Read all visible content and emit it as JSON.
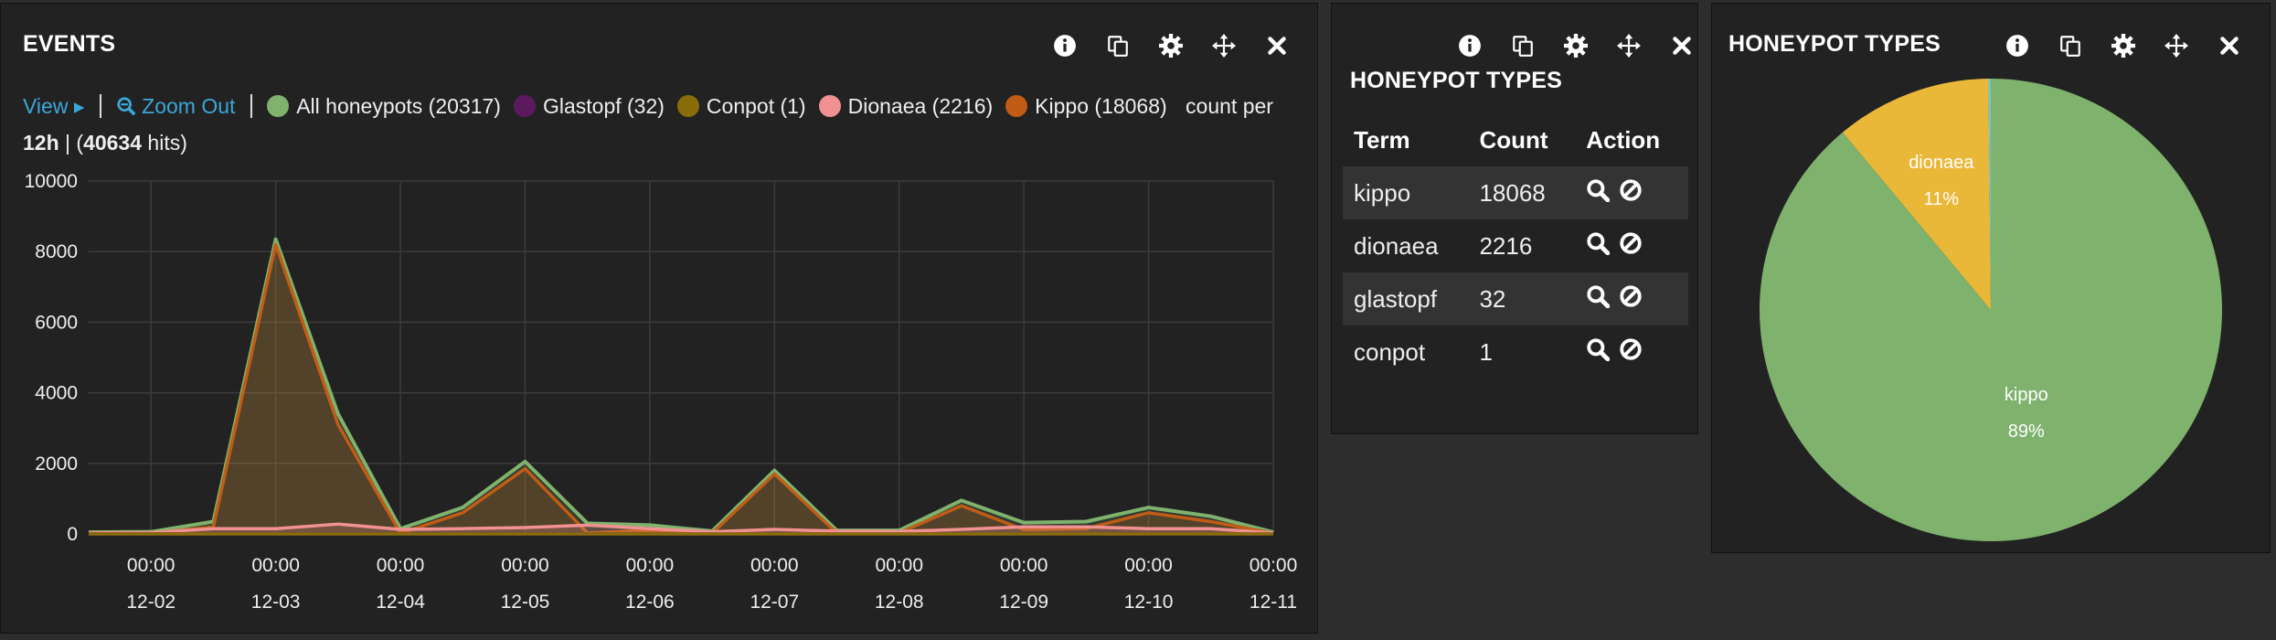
{
  "events_panel": {
    "title": "EVENTS",
    "view_label": "View",
    "zoom_label": "Zoom Out",
    "legend": [
      {
        "label": "All honeypots (20317)",
        "color": "#7eb26d"
      },
      {
        "label": "Glastopf (32)",
        "color": "#5c1a5e"
      },
      {
        "label": "Conpot (1)",
        "color": "#8a6d0b"
      },
      {
        "label": "Dionaea (2216)",
        "color": "#f29191"
      },
      {
        "label": "Kippo (18068)",
        "color": "#c15c17"
      }
    ],
    "count_per_text": "count per",
    "interval": "12h",
    "hits_open": " | (",
    "hits": "40634",
    "hits_close": " hits)"
  },
  "chart_data": {
    "type": "area",
    "xlabel": "",
    "ylabel": "",
    "ylim": [
      0,
      10000
    ],
    "yticks": [
      "10000",
      "8000",
      "6000",
      "4000",
      "2000",
      "0"
    ],
    "xtick_times": [
      "00:00",
      "00:00",
      "00:00",
      "00:00",
      "00:00",
      "00:00",
      "00:00",
      "00:00",
      "00:00",
      "00:00"
    ],
    "xtick_dates": [
      "12-02",
      "12-03",
      "12-04",
      "12-05",
      "12-06",
      "12-07",
      "12-08",
      "12-09",
      "12-10",
      "12-11"
    ],
    "x": [
      "12-01 12:00",
      "12-02 00:00",
      "12-02 12:00",
      "12-03 00:00",
      "12-03 12:00",
      "12-04 00:00",
      "12-04 12:00",
      "12-05 00:00",
      "12-05 12:00",
      "12-06 00:00",
      "12-06 12:00",
      "12-07 00:00",
      "12-07 12:00",
      "12-08 00:00",
      "12-08 12:00",
      "12-09 00:00",
      "12-09 12:00",
      "12-10 00:00",
      "12-10 12:00",
      "12-11 00:00"
    ],
    "series": [
      {
        "name": "All honeypots",
        "color": "#7eb26d",
        "values": [
          50,
          60,
          350,
          8350,
          3400,
          150,
          750,
          2050,
          300,
          250,
          80,
          1800,
          100,
          100,
          950,
          320,
          350,
          750,
          500,
          50
        ]
      },
      {
        "name": "Kippo",
        "color": "#c15c17",
        "values": [
          20,
          20,
          200,
          8200,
          3100,
          20,
          600,
          1850,
          30,
          100,
          20,
          1700,
          20,
          30,
          800,
          120,
          150,
          600,
          350,
          20
        ]
      },
      {
        "name": "Dionaea",
        "color": "#f29191",
        "values": [
          30,
          40,
          150,
          150,
          280,
          130,
          150,
          180,
          250,
          150,
          60,
          130,
          80,
          70,
          130,
          200,
          200,
          150,
          150,
          30
        ]
      },
      {
        "name": "Glastopf",
        "color": "#5c1a5e",
        "values": [
          2,
          2,
          2,
          3,
          3,
          2,
          2,
          2,
          2,
          2,
          1,
          2,
          1,
          1,
          2,
          1,
          1,
          2,
          1,
          0
        ]
      },
      {
        "name": "Conpot",
        "color": "#8a6d0b",
        "values": [
          0,
          0,
          0,
          0,
          0,
          0,
          0,
          0,
          0,
          0,
          0,
          0,
          0,
          0,
          1,
          0,
          0,
          0,
          0,
          0
        ]
      }
    ]
  },
  "table_panel": {
    "title": "HONEYPOT TYPES",
    "headers": [
      "Term",
      "Count",
      "Action"
    ],
    "rows": [
      {
        "term": "kippo",
        "count": "18068"
      },
      {
        "term": "dionaea",
        "count": "2216"
      },
      {
        "term": "glastopf",
        "count": "32"
      },
      {
        "term": "conpot",
        "count": "1"
      }
    ]
  },
  "pie_panel": {
    "title": "HONEYPOT TYPES",
    "pie": {
      "type": "pie",
      "slices": [
        {
          "label": "kippo",
          "pct_label": "89%",
          "value": 18068,
          "color": "#7eb26d"
        },
        {
          "label": "dionaea",
          "pct_label": "11%",
          "value": 2216,
          "color": "#eab839"
        },
        {
          "label": "glastopf",
          "pct_label": "",
          "value": 32,
          "color": "#6ed0e0"
        },
        {
          "label": "conpot",
          "pct_label": "",
          "value": 1,
          "color": "#ef843c"
        }
      ]
    }
  },
  "icons": {
    "info": "info-icon",
    "duplicate": "duplicate-icon",
    "settings": "gear-icon",
    "move": "move-icon",
    "close": "close-icon",
    "search": "search-icon",
    "exclude": "ban-icon"
  }
}
